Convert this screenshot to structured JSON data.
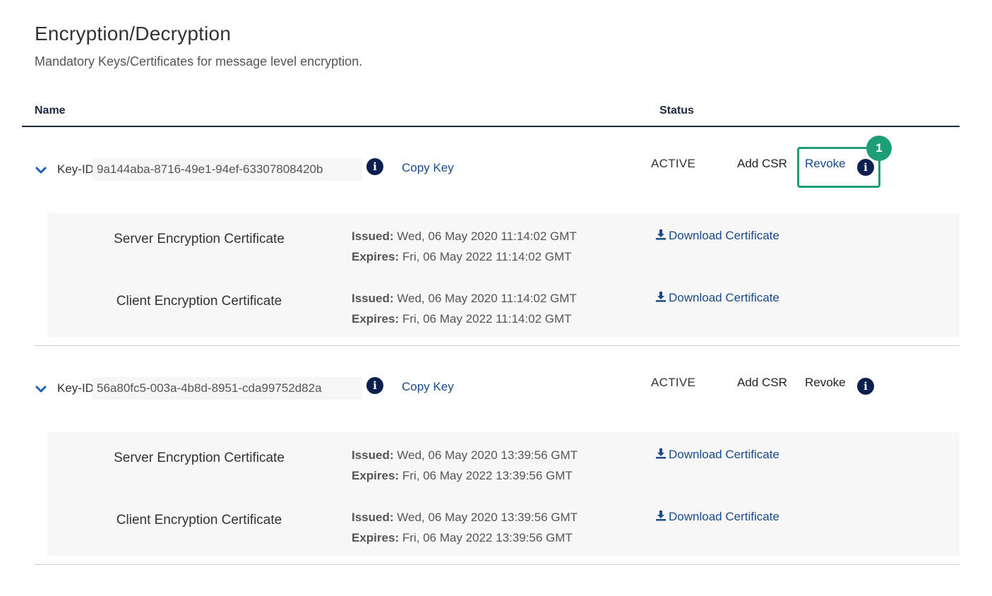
{
  "page": {
    "title": "Encryption/Decryption",
    "subtitle": "Mandatory Keys/Certificates for message level encryption."
  },
  "table": {
    "headers": {
      "name": "Name",
      "status": "Status"
    }
  },
  "keys": [
    {
      "key_label": "Key-ID:",
      "key_id": "9a144aba-8716-49e1-94ef-63307808420b",
      "copy_label": "Copy Key",
      "status": "ACTIVE",
      "add_csr": "Add CSR",
      "revoke": "Revoke",
      "certificates": [
        {
          "name": "Server Encryption Certificate",
          "issued_label": "Issued:",
          "issued": "Wed, 06 May 2020 11:14:02 GMT",
          "expires_label": "Expires:",
          "expires": "Fri, 06 May 2022 11:14:02 GMT",
          "download": "Download Certificate"
        },
        {
          "name": "Client Encryption Certificate",
          "issued_label": "Issued:",
          "issued": "Wed, 06 May 2020 11:14:02 GMT",
          "expires_label": "Expires:",
          "expires": "Fri, 06 May 2022 11:14:02 GMT",
          "download": "Download Certificate"
        }
      ]
    },
    {
      "key_label": "Key-ID:",
      "key_id": "56a80fc5-003a-4b8d-8951-cda99752d82a",
      "copy_label": "Copy Key",
      "status": "ACTIVE",
      "add_csr": "Add CSR",
      "revoke": "Revoke",
      "certificates": [
        {
          "name": "Server Encryption Certificate",
          "issued_label": "Issued:",
          "issued": "Wed, 06 May 2020 13:39:56 GMT",
          "expires_label": "Expires:",
          "expires": "Fri, 06 May 2022 13:39:56 GMT",
          "download": "Download Certificate"
        },
        {
          "name": "Client Encryption Certificate",
          "issued_label": "Issued:",
          "issued": "Wed, 06 May 2020 13:39:56 GMT",
          "expires_label": "Expires:",
          "expires": "Fri, 06 May 2022 13:39:56 GMT",
          "download": "Download Certificate"
        }
      ]
    }
  ],
  "callout": {
    "number": "1"
  },
  "icons": {
    "chevron": "chevron-down-icon",
    "info": "info-icon",
    "download": "download-icon"
  },
  "colors": {
    "link": "#1a4a8a",
    "info_icon": "#0c1f4f",
    "callout": "#1e9e75",
    "header_rule": "#1e2a3e"
  }
}
